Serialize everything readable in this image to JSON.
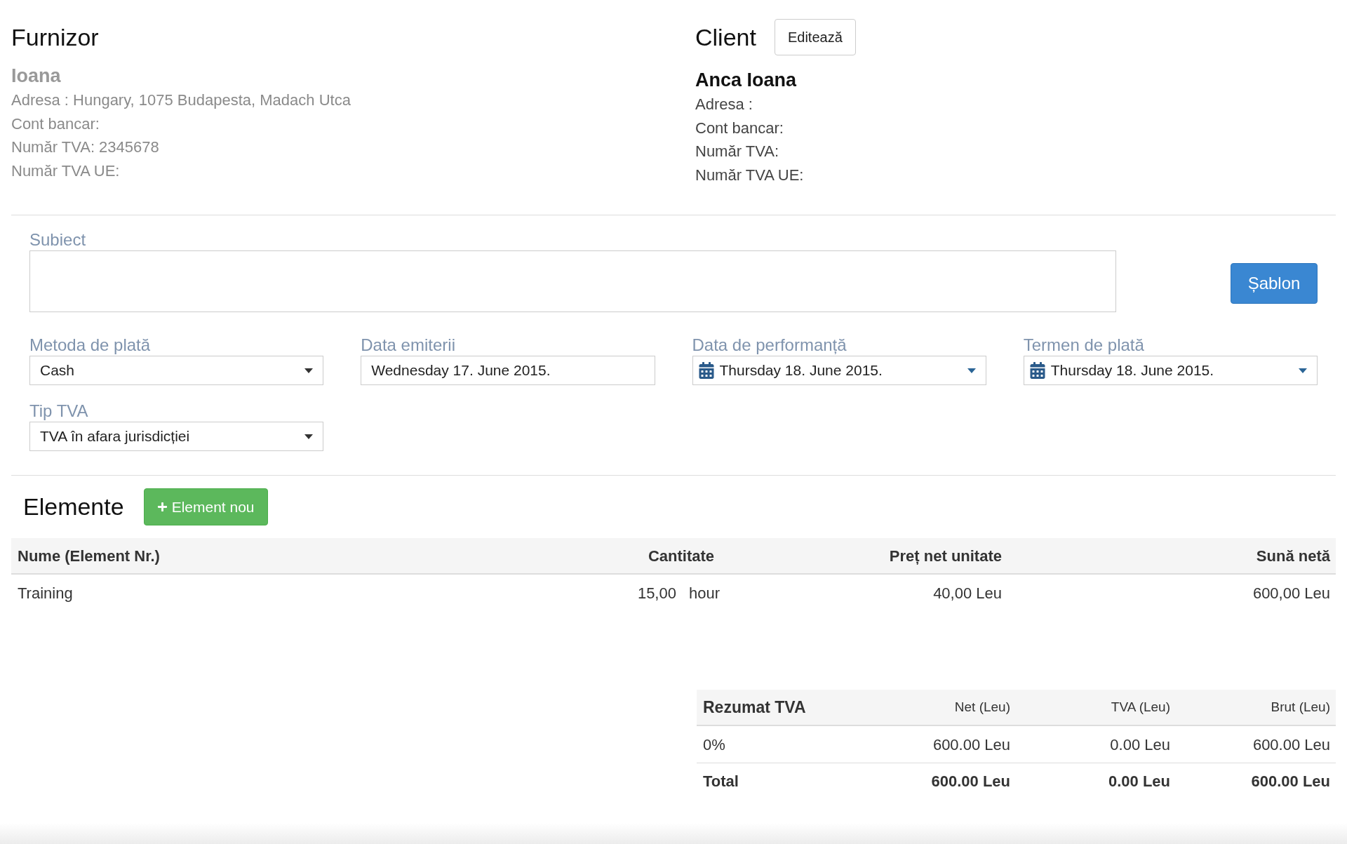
{
  "supplier": {
    "title": "Furnizor",
    "name": "Ioana",
    "lines": [
      "Adresa : Hungary, 1075 Budapesta, Madach Utca",
      "Cont bancar:",
      "Număr TVA: 2345678",
      "Număr TVA UE:"
    ]
  },
  "client": {
    "title": "Client",
    "edit_button": "Editează",
    "name": "Anca Ioana",
    "lines": [
      "Adresa :",
      "Cont bancar:",
      "Număr TVA:",
      "Număr TVA UE:"
    ]
  },
  "subject": {
    "label": "Subiect"
  },
  "template_button": "Șablon",
  "fields": [
    {
      "label": "Metoda de plată",
      "value": "Cash",
      "kind": "select"
    },
    {
      "label": "Data emiterii",
      "value": "Wednesday 17. June 2015.",
      "kind": "text"
    },
    {
      "label": "Data de performanță",
      "value": "Thursday 18. June 2015.",
      "kind": "date"
    },
    {
      "label": "Termen de plată",
      "value": "Thursday 18. June 2015.",
      "kind": "date"
    },
    {
      "label": "Tip TVA",
      "value": "TVA în afara jurisdicției",
      "kind": "select"
    }
  ],
  "items": {
    "title": "Elemente",
    "add_button": "Element nou",
    "columns": [
      "Nume (Element Nr.)",
      "Cantitate",
      "Preț net unitate",
      "Sună netă"
    ],
    "rows": [
      {
        "name": "Training",
        "quantity": "15,00",
        "unit": "hour",
        "unit_price": "40,00 Leu",
        "net_sum": "600,00 Leu"
      }
    ]
  },
  "vat_summary": {
    "columns": [
      "Rezumat TVA",
      "Net (Leu)",
      "TVA (Leu)",
      "Brut (Leu)"
    ],
    "rows": [
      {
        "kind": "rate",
        "cells": [
          "0%",
          "600.00 Leu",
          "0.00 Leu",
          "600.00 Leu"
        ]
      },
      {
        "kind": "total",
        "cells": [
          "Total",
          "600.00 Leu",
          "0.00 Leu",
          "600.00 Leu"
        ]
      }
    ]
  }
}
